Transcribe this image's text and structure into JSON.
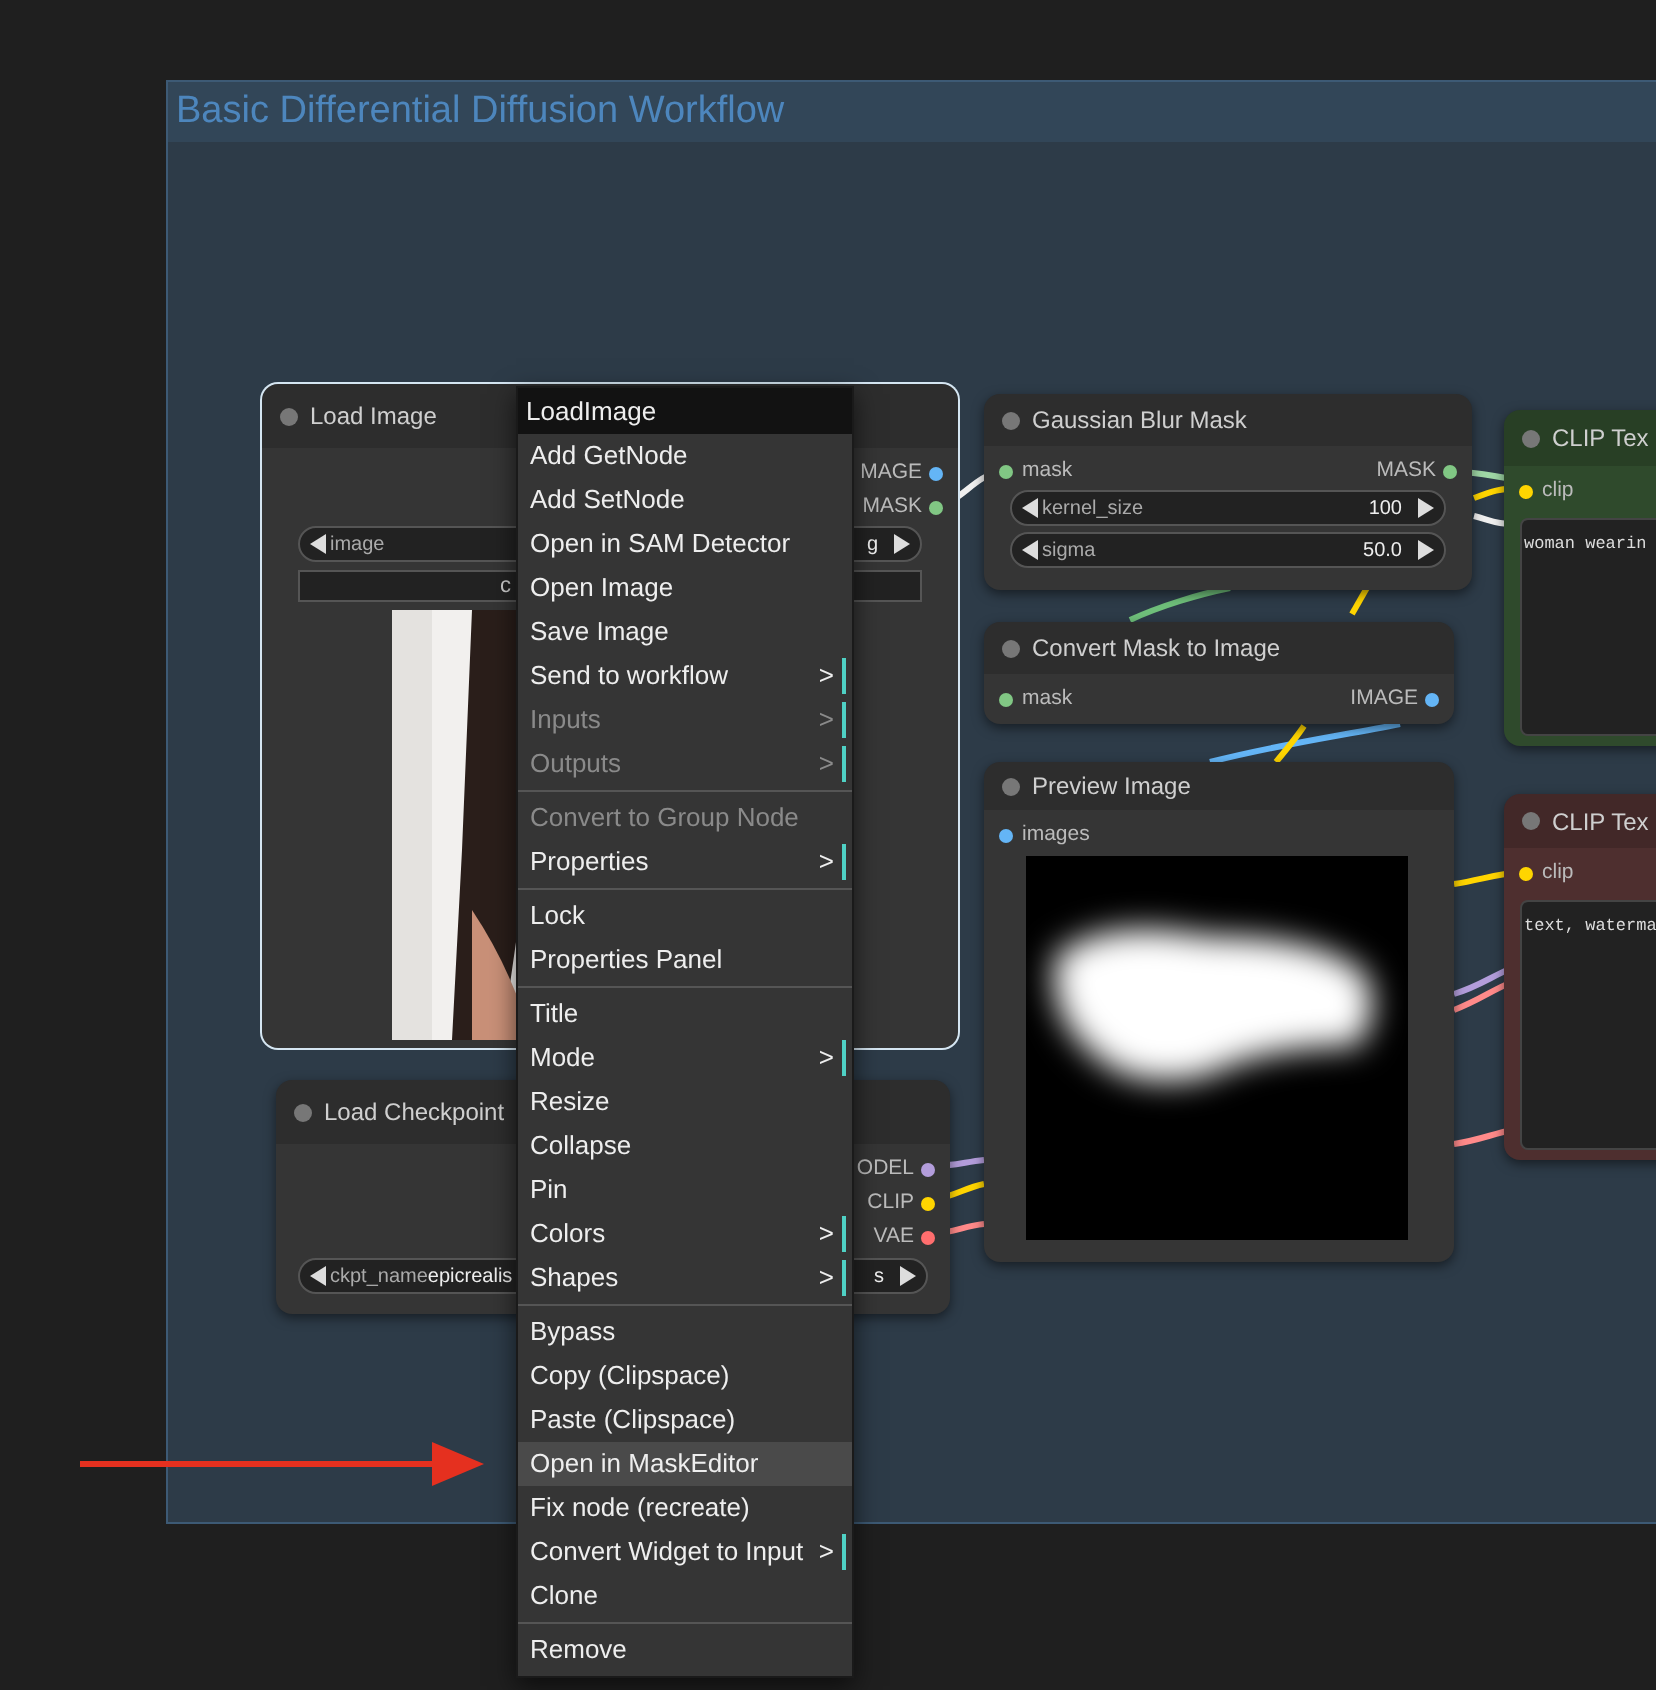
{
  "group": {
    "title": "Basic Differential Diffusion Workflow"
  },
  "nodes": [
    {
      "title": "Load Image",
      "selected": true,
      "outputs": [
        {
          "label": "MAGE",
          "color": "#64b5f6"
        },
        {
          "label": "MASK",
          "color": "#81c784"
        }
      ],
      "widgets": [
        {
          "label": "image",
          "value": "g"
        }
      ],
      "button": "c"
    },
    {
      "title": "Load Checkpoint",
      "selected": false,
      "outputs": [
        {
          "label": "ODEL",
          "color": "#b39ddb"
        },
        {
          "label": "CLIP",
          "color": "#ffd500"
        },
        {
          "label": "VAE",
          "color": "#ff6e6e"
        }
      ],
      "widgets": [
        {
          "label": "ckpt_name",
          "lead": "epicrealis",
          "value": "s"
        }
      ]
    },
    {
      "title": "Gaussian Blur Mask",
      "selected": false,
      "inputs": [
        {
          "label": "mask",
          "color": "#81c784"
        }
      ],
      "outputs": [
        {
          "label": "MASK",
          "color": "#81c784"
        }
      ],
      "widgets": [
        {
          "label": "kernel_size",
          "value": "100"
        },
        {
          "label": "sigma",
          "value": "50.0"
        }
      ]
    },
    {
      "title": "Convert Mask to Image",
      "selected": false,
      "inputs": [
        {
          "label": "mask",
          "color": "#81c784"
        }
      ],
      "outputs": [
        {
          "label": "IMAGE",
          "color": "#64b5f6"
        }
      ]
    },
    {
      "title": "Preview Image",
      "selected": false,
      "inputs": [
        {
          "label": "images",
          "color": "#64b5f6"
        }
      ]
    },
    {
      "title": "CLIP Tex",
      "selected": false,
      "color": "#2f4a2c",
      "inputs": [
        {
          "label": "clip",
          "color": "#ffd500"
        }
      ],
      "text": "woman wearin"
    },
    {
      "title": "CLIP Tex",
      "selected": false,
      "color": "#4e2f2f",
      "inputs": [
        {
          "label": "clip",
          "color": "#ffd500"
        }
      ],
      "text": "text, waterma"
    }
  ],
  "context_menu": {
    "title": "LoadImage",
    "items": [
      {
        "kind": "item",
        "label": "Add GetNode",
        "disabled": false,
        "selected": false
      },
      {
        "kind": "item",
        "label": "Add SetNode",
        "disabled": false,
        "selected": false
      },
      {
        "kind": "item",
        "label": "Open in SAM Detector",
        "disabled": false,
        "selected": false
      },
      {
        "kind": "item",
        "label": "Open Image",
        "disabled": false,
        "selected": false
      },
      {
        "kind": "item",
        "label": "Save Image",
        "disabled": false,
        "selected": false
      },
      {
        "kind": "item",
        "label": "Send to workflow",
        "arrow": ">",
        "disabled": false,
        "selected": false
      },
      {
        "kind": "item",
        "label": "Inputs",
        "arrow": ">",
        "disabled": true,
        "selected": false
      },
      {
        "kind": "item",
        "label": "Outputs",
        "arrow": ">",
        "disabled": true,
        "selected": false
      },
      {
        "kind": "separator"
      },
      {
        "kind": "item",
        "label": "Convert to Group Node",
        "disabled": true,
        "selected": false
      },
      {
        "kind": "item",
        "label": "Properties",
        "arrow": ">",
        "disabled": false,
        "selected": false
      },
      {
        "kind": "separator"
      },
      {
        "kind": "item",
        "label": "Lock",
        "disabled": false,
        "selected": false
      },
      {
        "kind": "item",
        "label": "Properties Panel",
        "disabled": false,
        "selected": false
      },
      {
        "kind": "separator"
      },
      {
        "kind": "item",
        "label": "Title",
        "disabled": false,
        "selected": false
      },
      {
        "kind": "item",
        "label": "Mode",
        "arrow": ">",
        "disabled": false,
        "selected": false
      },
      {
        "kind": "item",
        "label": "Resize",
        "disabled": false,
        "selected": false
      },
      {
        "kind": "item",
        "label": "Collapse",
        "disabled": false,
        "selected": false
      },
      {
        "kind": "item",
        "label": "Pin",
        "disabled": false,
        "selected": false
      },
      {
        "kind": "item",
        "label": "Colors",
        "arrow": ">",
        "disabled": false,
        "selected": false
      },
      {
        "kind": "item",
        "label": "Shapes",
        "arrow": ">",
        "disabled": false,
        "selected": false
      },
      {
        "kind": "separator"
      },
      {
        "kind": "item",
        "label": "Bypass",
        "disabled": false,
        "selected": false
      },
      {
        "kind": "item",
        "label": "Copy (Clipspace)",
        "disabled": false,
        "selected": false
      },
      {
        "kind": "item",
        "label": "Paste (Clipspace)",
        "disabled": false,
        "selected": false
      },
      {
        "kind": "item",
        "label": "Open in MaskEditor",
        "disabled": false,
        "selected": true
      },
      {
        "kind": "item",
        "label": "Fix node (recreate)",
        "disabled": false,
        "selected": false
      },
      {
        "kind": "item",
        "label": "Convert Widget to Input",
        "arrow": ">",
        "disabled": false,
        "selected": false
      },
      {
        "kind": "item",
        "label": "Clone",
        "disabled": false,
        "selected": false
      },
      {
        "kind": "separator"
      },
      {
        "kind": "item",
        "label": "Remove",
        "disabled": false,
        "selected": false
      }
    ]
  }
}
